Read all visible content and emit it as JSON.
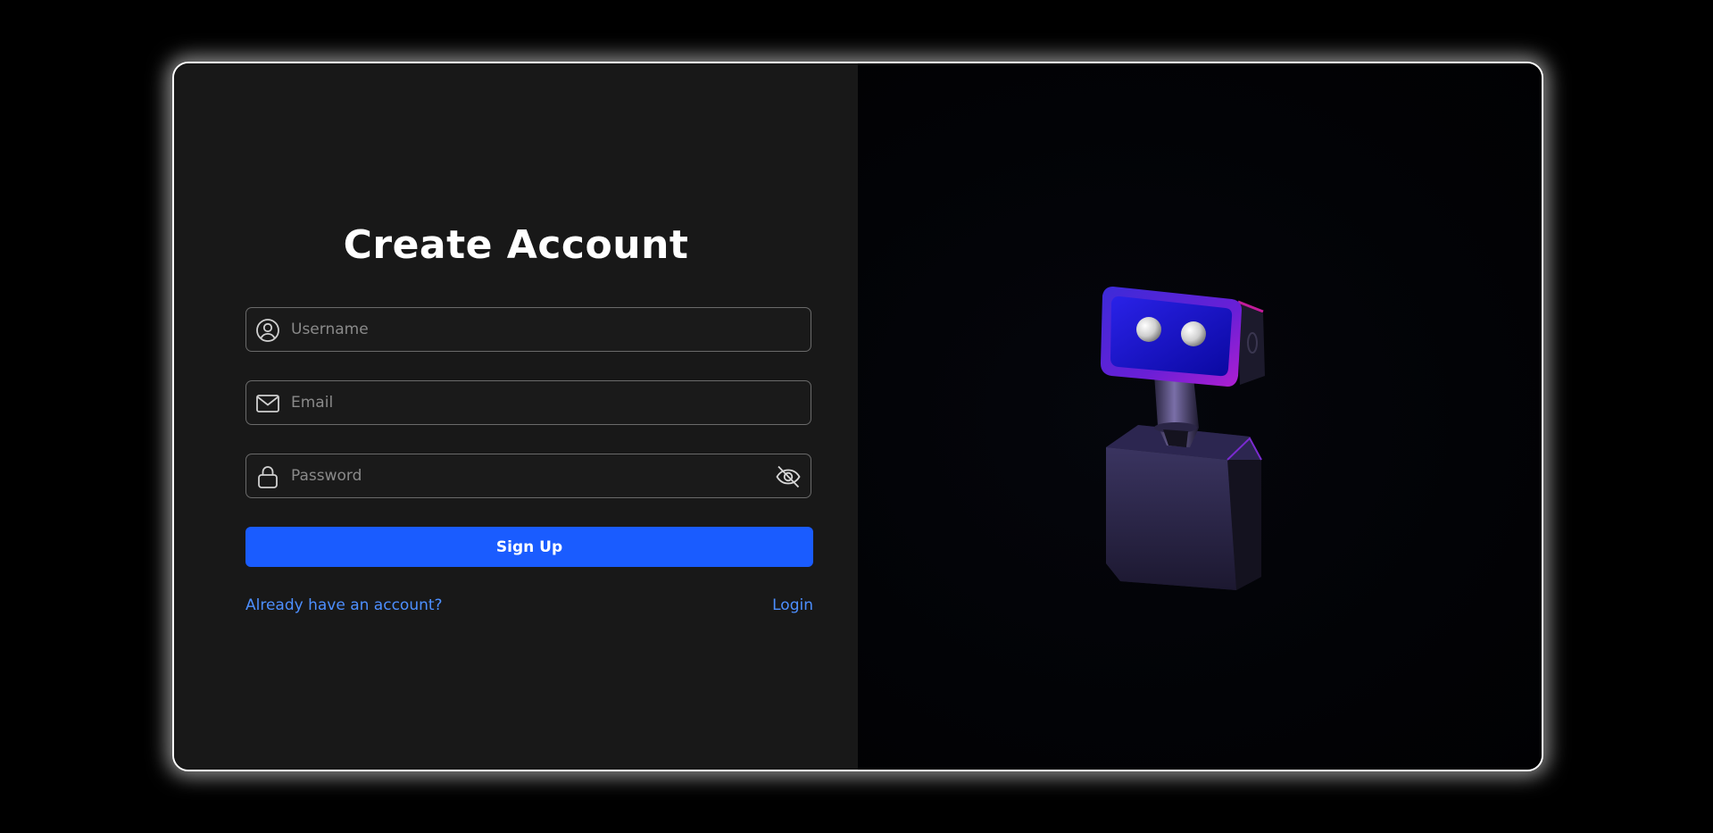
{
  "form": {
    "title": "Create Account",
    "username_placeholder": "Username",
    "email_placeholder": "Email",
    "password_placeholder": "Password",
    "signup_label": "Sign Up",
    "already_account_text": "Already have an account?",
    "login_link": "Login"
  },
  "icons": {
    "username": "user-circle-icon",
    "email": "envelope-icon",
    "password": "lock-icon",
    "toggle_password": "eye-off-icon"
  },
  "colors": {
    "background": "#000000",
    "panel_left": "#181818",
    "panel_right": "#020306",
    "accent": "#1a5cff",
    "link": "#4d8fff",
    "card_border": "#ffffff"
  }
}
